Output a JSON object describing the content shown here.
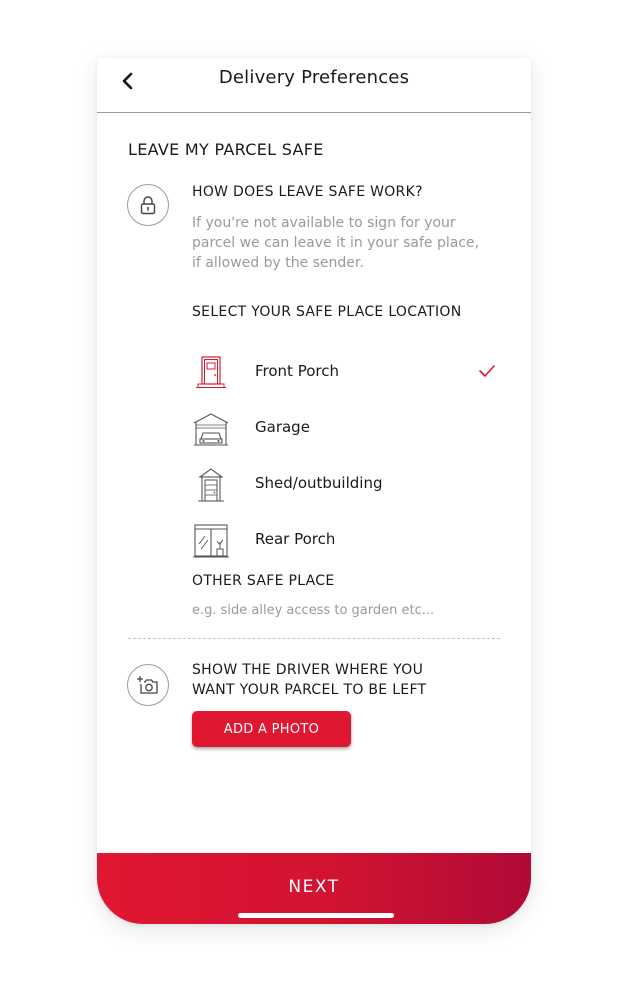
{
  "header": {
    "title": "Delivery Preferences",
    "back_icon": "chevron-left-icon"
  },
  "leave_safe": {
    "section_title": "LEAVE MY PARCEL SAFE",
    "info_icon": "lock-icon",
    "info_heading": "HOW DOES LEAVE SAFE WORK?",
    "info_lines": [
      "If you're not available to sign for your",
      "parcel we can leave it in your safe place,",
      "if allowed by the sender."
    ]
  },
  "locations": {
    "heading": "SELECT YOUR SAFE PLACE LOCATION",
    "items": [
      {
        "label": "Front Porch",
        "icon": "front-door-icon",
        "selected": true
      },
      {
        "label": "Garage",
        "icon": "garage-icon",
        "selected": false
      },
      {
        "label": "Shed/outbuilding",
        "icon": "shed-icon",
        "selected": false
      },
      {
        "label": "Rear Porch",
        "icon": "rear-porch-icon",
        "selected": false
      }
    ],
    "selected_icon": "checkmark-icon"
  },
  "other": {
    "heading": "OTHER SAFE PLACE",
    "value": "",
    "placeholder": "e.g. side alley access to garden etc..."
  },
  "photo": {
    "icon": "add-photo-icon",
    "heading_lines": [
      "SHOW THE DRIVER WHERE YOU",
      "WANT YOUR PARCEL TO BE LEFT"
    ],
    "button_label": "ADD A PHOTO"
  },
  "footer": {
    "next_label": "NEXT"
  },
  "colors": {
    "accent": "#e01731",
    "accent_dark": "#b00a37",
    "muted_text": "#9a9a9a"
  }
}
